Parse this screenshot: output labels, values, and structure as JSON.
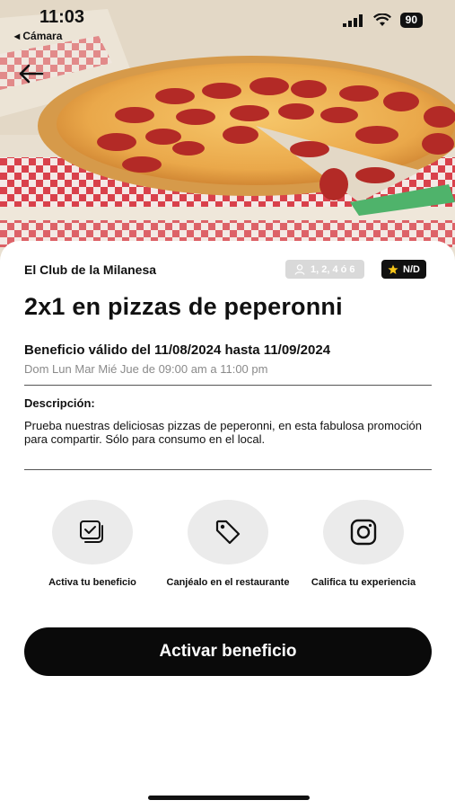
{
  "status_bar": {
    "time": "11:03",
    "back_app": "◂ Cámara",
    "battery": "90"
  },
  "header": {
    "back_icon": "arrow-left-icon"
  },
  "restaurant": {
    "name": "El Club de la Milanesa"
  },
  "badges": {
    "people": "1, 2, 4 ó 6",
    "rating": "N/D"
  },
  "offer": {
    "title": "2x1 en pizzas de peperonni",
    "validity": "Beneficio válido del 11/08/2024 hasta 11/09/2024",
    "schedule": "Dom Lun Mar Mié Jue  de 09:00 am a 11:00 pm"
  },
  "description": {
    "label": "Descripción:",
    "text": "Prueba nuestras deliciosas pizzas de peperonni, en esta fabulosa promoción para compartir. Sólo para consumo en el local."
  },
  "steps": [
    {
      "label": "Activa tu beneficio",
      "icon": "check-cards-icon"
    },
    {
      "label": "Canjéalo en el restaurante",
      "icon": "tag-icon"
    },
    {
      "label": "Califica tu experiencia",
      "icon": "instagram-icon"
    }
  ],
  "cta": {
    "label": "Activar beneficio"
  },
  "colors": {
    "primary": "#0a0a0a",
    "badge_gray": "#d9d9d9",
    "star": "#f5c518",
    "box_red": "#d9414b"
  }
}
